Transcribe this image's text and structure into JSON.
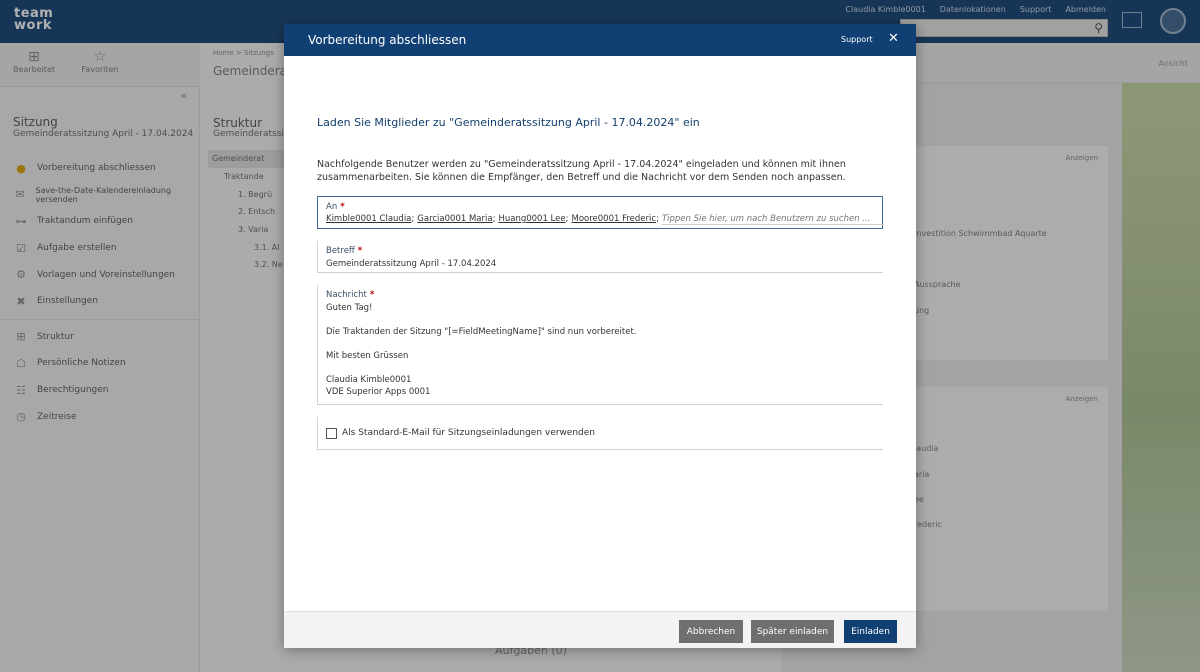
{
  "app": {
    "logo_line1": "team",
    "logo_line2": "work",
    "top_links": [
      "Claudia Kimble0001",
      "Datenlokationen",
      "Support",
      "Abmelden"
    ]
  },
  "favorites": {
    "items": [
      {
        "label": "Bearbeitet",
        "icon": "sitemap-icon"
      },
      {
        "label": "Favoriten",
        "icon": "star-icon"
      }
    ]
  },
  "left_panel": {
    "title": "Sitzung",
    "subtitle": "Gemeinderatssitzung April - 17.04.2024",
    "menu": [
      {
        "label": "Vorbereitung abschliessen",
        "icon": "check-circle-icon"
      },
      {
        "label": "Save-the-Date-Kalendereinladung versenden",
        "icon": "mail-icon"
      },
      {
        "label": "Traktandum einfügen",
        "icon": "agenda-item-icon"
      },
      {
        "label": "Aufgabe erstellen",
        "icon": "task-icon"
      },
      {
        "label": "Vorlagen und Voreinstellungen",
        "icon": "gear-icon"
      },
      {
        "label": "Einstellungen",
        "icon": "tools-icon"
      }
    ],
    "menu2": [
      {
        "label": "Struktur",
        "icon": "structure-icon"
      },
      {
        "label": "Persönliche Notizen",
        "icon": "note-icon"
      },
      {
        "label": "Berechtigungen",
        "icon": "users-icon"
      },
      {
        "label": "Zeitreise",
        "icon": "history-icon"
      }
    ]
  },
  "mid_panel": {
    "breadcrumb": "Home > Sitzungs",
    "title": "Gemeinderats",
    "struct_title": "Struktur",
    "struct_sub": "Gemeinderatssit",
    "tree": [
      "Gemeinderat",
      "Traktande",
      "1. Begrü",
      "2. Entsch",
      "3. Varia",
      "3.1. Al",
      "3.2. Ne"
    ],
    "aufgaben": "Aufgaben (0)"
  },
  "right_panel": {
    "ansicht": "Ansicht",
    "card1_anz": "Anzeigen",
    "card1_lines": [
      "Investition Schwimmbad Aquarte",
      "Aussprache",
      "ung"
    ],
    "card2_anz": "Anzeigen",
    "card2_lines": [
      "laudia",
      "aria",
      "ee",
      "rederic"
    ]
  },
  "dialog": {
    "title": "Vorbereitung abschliessen",
    "support": "Support",
    "heading": "Laden Sie Mitglieder zu \"Gemeinderatssitzung April - 17.04.2024\" ein",
    "intro": "Nachfolgende Benutzer werden zu \"Gemeinderatssitzung April - 17.04.2024\" eingeladen und können mit ihnen zusammenarbeiten. Sie können die Empfänger, den Betreff und die Nachricht vor dem Senden noch anpassen.",
    "to": {
      "label": "An",
      "recipients": [
        "Kimble0001 Claudia",
        "Garcia0001 Maria",
        "Huang0001 Lee",
        "Moore0001 Frederic"
      ],
      "placeholder": "Tippen Sie hier, um nach Benutzern zu suchen ..."
    },
    "subject": {
      "label": "Betreff",
      "value": "Gemeinderatssitzung April - 17.04.2024"
    },
    "message": {
      "label": "Nachricht",
      "lines": [
        "Guten Tag!",
        "",
        "Die Traktanden der Sitzung \"[=FieldMeetingName]\" sind nun vorbereitet.",
        "",
        "Mit besten Grüssen",
        "",
        "Claudia Kimble0001",
        "VDE Superior Apps 0001"
      ]
    },
    "default_checkbox": {
      "label": "Als Standard-E-Mail für Sitzungseinladungen verwenden",
      "checked": false
    },
    "buttons": {
      "cancel": "Abbrechen",
      "later": "Später einladen",
      "invite": "Einladen"
    }
  },
  "colors": {
    "brand": "#0f3f73",
    "required": "#c00000",
    "button_gray": "#6f6f6f"
  }
}
